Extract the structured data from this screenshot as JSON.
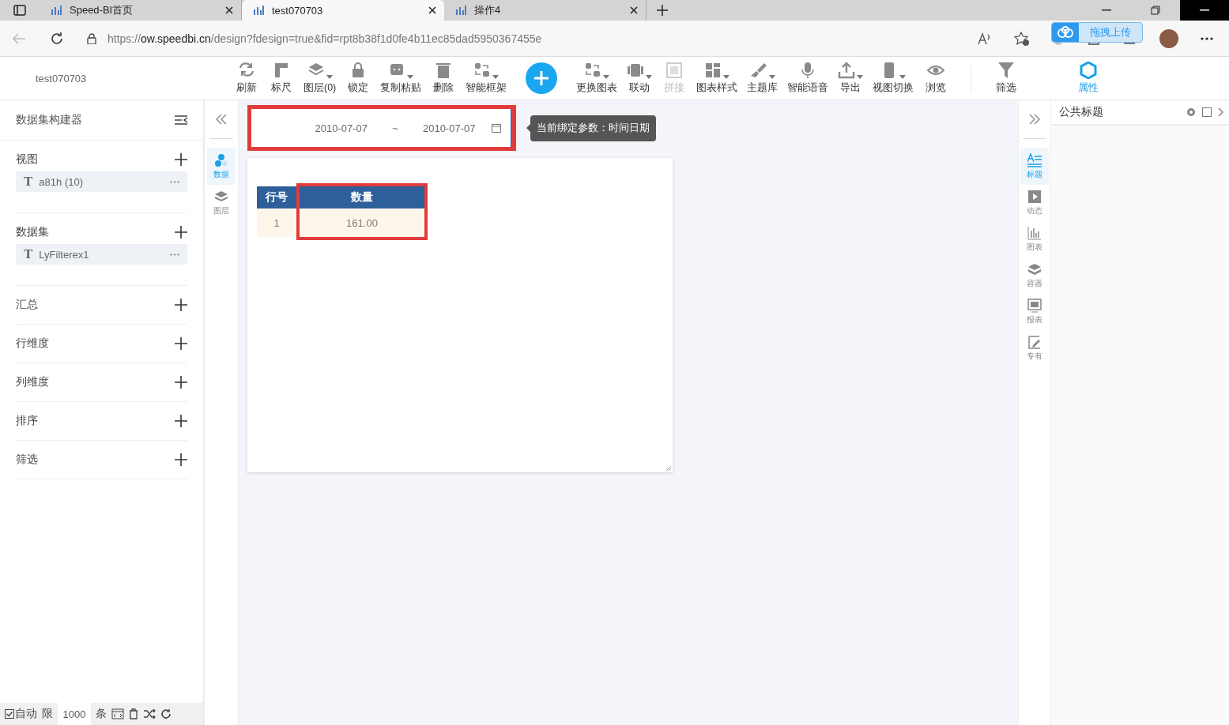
{
  "browser": {
    "tabs": [
      {
        "title": "Speed-BI首页",
        "selected": false
      },
      {
        "title": "test070703",
        "selected": true
      },
      {
        "title": "操作4",
        "selected": false
      }
    ],
    "url_scheme": "https://",
    "url_host": "ow.speedbi.cn",
    "url_path": "/design?fdesign=true&fid=rpt8b38f1d0fe4b11ec85dad5950367455e",
    "upload_label": "拖拽上传"
  },
  "app": {
    "report_name": "test070703",
    "toolbar": [
      {
        "label": "刷新",
        "menu": false,
        "disabled": false
      },
      {
        "label": "标尺",
        "menu": false,
        "disabled": false
      },
      {
        "label": "图层(0)",
        "menu": true,
        "disabled": false
      },
      {
        "label": "锁定",
        "menu": false,
        "disabled": false
      },
      {
        "label": "复制粘贴",
        "menu": true,
        "disabled": false
      },
      {
        "label": "删除",
        "menu": false,
        "disabled": false
      },
      {
        "label": "智能框架",
        "menu": true,
        "disabled": false
      },
      {
        "label": "更换图表",
        "menu": true,
        "disabled": false
      },
      {
        "label": "联动",
        "menu": true,
        "disabled": false
      },
      {
        "label": "拼接",
        "menu": false,
        "disabled": true
      },
      {
        "label": "图表样式",
        "menu": true,
        "disabled": false
      },
      {
        "label": "主题库",
        "menu": true,
        "disabled": false
      },
      {
        "label": "智能语音",
        "menu": false,
        "disabled": false
      },
      {
        "label": "导出",
        "menu": true,
        "disabled": false
      },
      {
        "label": "视图切换",
        "menu": true,
        "disabled": false
      },
      {
        "label": "浏览",
        "menu": false,
        "disabled": false
      }
    ],
    "side_tools": [
      {
        "label": "筛选",
        "selected": false
      },
      {
        "label": "属性",
        "selected": true
      }
    ]
  },
  "builder": {
    "title": "数据集构建器",
    "sections": [
      {
        "label": "视图",
        "items": [
          {
            "type_mark": "T",
            "name": "a81h (10)"
          }
        ]
      },
      {
        "label": "数据集",
        "items": [
          {
            "type_mark": "T",
            "name": "LyFilterex1"
          }
        ]
      },
      {
        "label": "汇总"
      },
      {
        "label": "行维度"
      },
      {
        "label": "列维度"
      },
      {
        "label": "排序"
      },
      {
        "label": "筛选"
      }
    ]
  },
  "status_bar": {
    "auto_checked": true,
    "auto_label": "自动",
    "limit_label": "限",
    "limit_value": "1000",
    "unit": "条"
  },
  "left_rail": [
    {
      "label": "数据",
      "selected": true
    },
    {
      "label": "图层",
      "selected": false
    }
  ],
  "canvas": {
    "date_filter": {
      "start": "2010-07-07",
      "separator": "~",
      "end": "2010-07-07",
      "highlighted": true
    },
    "tooltip": "当前绑定参数：时间日期",
    "table": {
      "columns": [
        {
          "label": "行号",
          "highlighted": false
        },
        {
          "label": "数量",
          "highlighted": true
        }
      ],
      "rows": [
        [
          "1",
          "161.00"
        ]
      ]
    }
  },
  "right_rail": [
    {
      "label": "标题",
      "selected": true
    },
    {
      "label": "动态",
      "selected": false
    },
    {
      "label": "图表",
      "selected": false
    },
    {
      "label": "容器",
      "selected": false
    },
    {
      "label": "报表",
      "selected": false
    },
    {
      "label": "专有",
      "selected": false
    }
  ],
  "properties": {
    "title": "公共标题"
  }
}
